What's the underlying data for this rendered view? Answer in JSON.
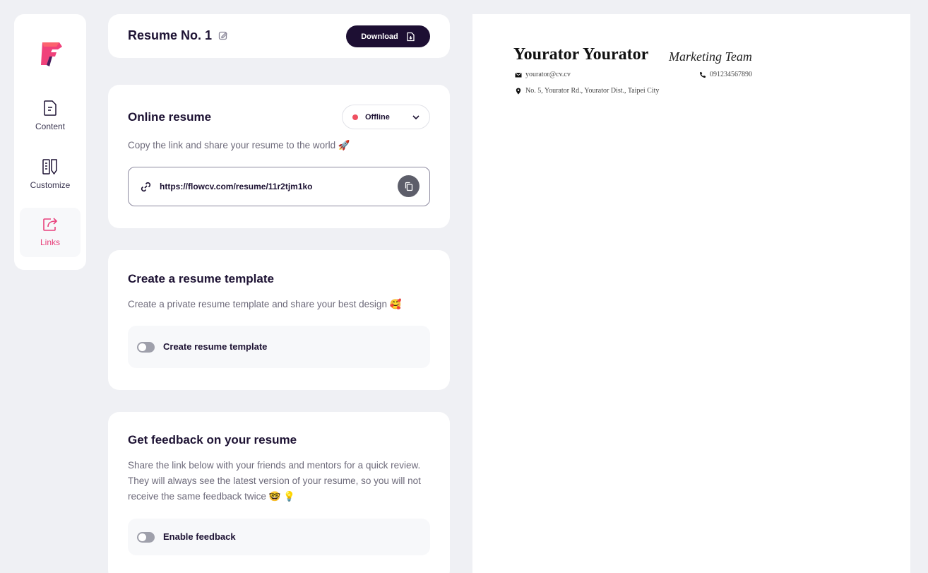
{
  "nav": {
    "items": [
      {
        "label": "Content",
        "icon": "document-icon"
      },
      {
        "label": "Customize",
        "icon": "palette-icon"
      },
      {
        "label": "Links",
        "icon": "share-icon",
        "active": true
      }
    ]
  },
  "header": {
    "title": "Resume No. 1",
    "download_label": "Download"
  },
  "online_resume": {
    "title": "Online resume",
    "status": "Offline",
    "status_color": "#ef5061",
    "description": "Copy the link and share your resume to the world 🚀",
    "url": "https://flowcv.com/resume/11r2tjm1ko"
  },
  "template": {
    "title": "Create a resume template",
    "description": "Create a private resume template and share your best design 🥰",
    "toggle_label": "Create resume template",
    "enabled": false
  },
  "feedback": {
    "title": "Get feedback on your resume",
    "description": "Share the link below with your friends and mentors for a quick review. They will always see the latest version of your resume, so you will not receive the same feedback twice 🤓 💡",
    "toggle_label": "Enable feedback",
    "enabled": false
  },
  "resume": {
    "name": "Yourator Yourator",
    "role": "Marketing Team",
    "email": "yourator@cv.cv",
    "phone": "091234567890",
    "address": "No. 5, Yourator Rd., Yourator Dist., Taipei City"
  },
  "colors": {
    "accent": "#e8417c",
    "primary": "#1d0f33",
    "background": "#eff0f4"
  }
}
